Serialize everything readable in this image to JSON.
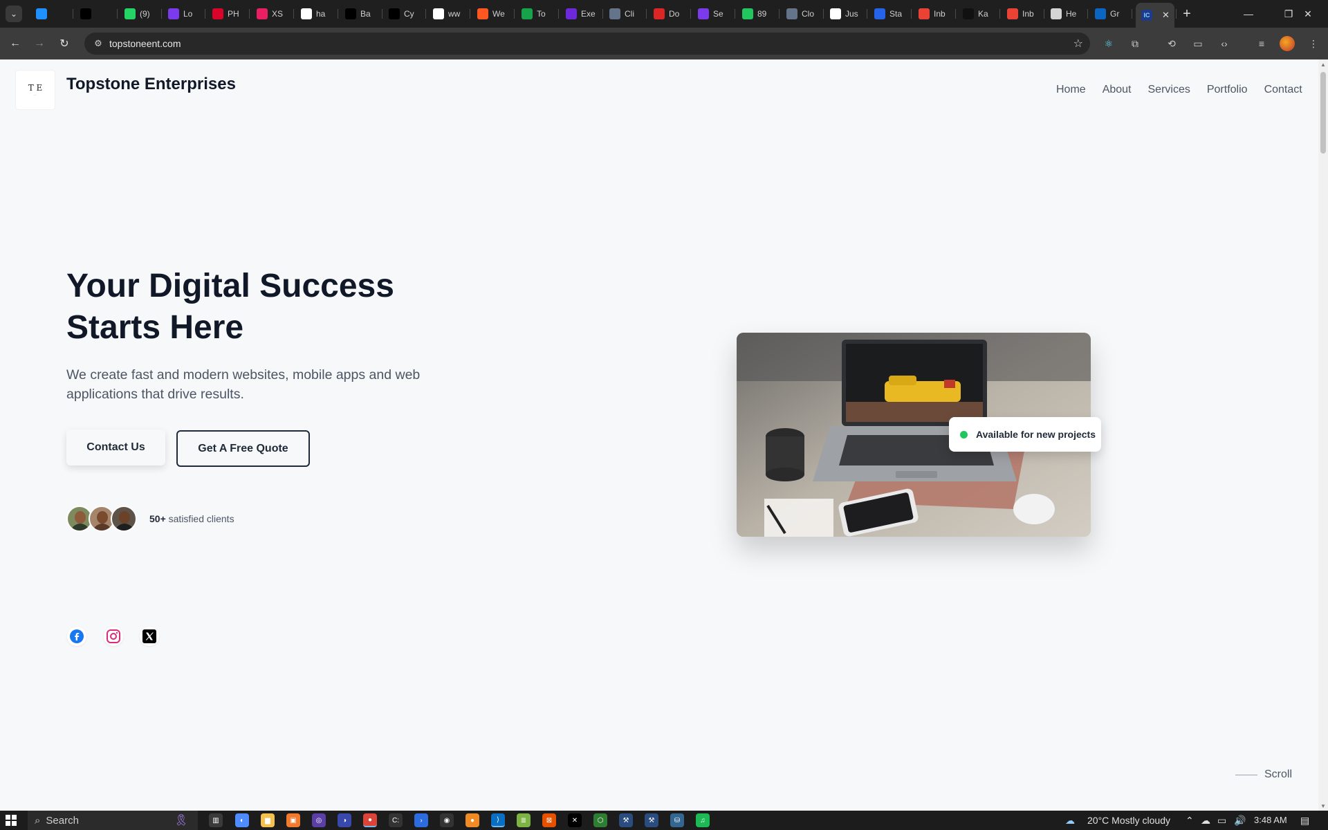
{
  "browser": {
    "tabs": [
      {
        "label": "",
        "favicon": "stripe-icon",
        "color": "#1e90ff"
      },
      {
        "label": "",
        "favicon": "x-icon",
        "color": "#000000"
      },
      {
        "label": "(9)",
        "favicon": "whatsapp-icon",
        "color": "#25d366"
      },
      {
        "label": "Lo",
        "favicon": "purple-u-icon",
        "color": "#7c3aed"
      },
      {
        "label": "PH",
        "favicon": "v-red-icon",
        "color": "#d90429"
      },
      {
        "label": "XS",
        "favicon": "hoi-icon",
        "color": "#e91e63"
      },
      {
        "label": "ha",
        "favicon": "house-icon",
        "color": "#ffffff"
      },
      {
        "label": "Ba",
        "favicon": "r-black-icon",
        "color": "#000000"
      },
      {
        "label": "Cy",
        "favicon": "r-black-icon",
        "color": "#000000"
      },
      {
        "label": "ww",
        "favicon": "white-square-icon",
        "color": "#ffffff"
      },
      {
        "label": "We",
        "favicon": "orange-icon",
        "color": "#ff5722"
      },
      {
        "label": "To",
        "favicon": "green-link-icon",
        "color": "#16a34a"
      },
      {
        "label": "Exe",
        "favicon": "bracket-icon",
        "color": "#6d28d9"
      },
      {
        "label": "Cli",
        "favicon": "cloud-icon",
        "color": "#64748b"
      },
      {
        "label": "Do",
        "favicon": "red-shield-icon",
        "color": "#dc2626"
      },
      {
        "label": "Se",
        "favicon": "purple-u-icon",
        "color": "#7c3aed"
      },
      {
        "label": "89",
        "favicon": "mic-icon",
        "color": "#22c55e"
      },
      {
        "label": "Clo",
        "favicon": "bars-icon",
        "color": "#64748b"
      },
      {
        "label": "Jus",
        "favicon": "w-icon",
        "color": "#ffffff"
      },
      {
        "label": "Sta",
        "favicon": "blue-circle-icon",
        "color": "#2563eb"
      },
      {
        "label": "Inb",
        "favicon": "gmail-icon",
        "color": "#ea4335"
      },
      {
        "label": "Ka",
        "favicon": "dark-icon",
        "color": "#111111"
      },
      {
        "label": "Inb",
        "favicon": "gmail-icon",
        "color": "#ea4335"
      },
      {
        "label": "He",
        "favicon": "ring-icon",
        "color": "#d4d4d4"
      },
      {
        "label": "Gr",
        "favicon": "linkedin-icon",
        "color": "#0a66c2"
      },
      {
        "label": "",
        "favicon": "youtube-icon",
        "color": "#ff0000"
      }
    ],
    "active_tab_favicon": "topstone-icon",
    "url": "topstoneent.com"
  },
  "site": {
    "brand": "Topstone Enterprises",
    "logo_mark": "T E",
    "nav": [
      "Home",
      "About",
      "Services",
      "Portfolio",
      "Contact"
    ],
    "hero": {
      "title_line1": "Your Digital Success",
      "title_line2": "Starts Here",
      "subtitle": "We create fast and modern websites, mobile apps and web applications that drive results.",
      "cta_primary": "Contact Us",
      "cta_secondary": "Get A Free Quote",
      "clients_count": "50+",
      "clients_text": "satisfied clients",
      "badge": "Available for new projects",
      "scroll": "Scroll"
    },
    "social": [
      "facebook-icon",
      "instagram-icon",
      "x-icon"
    ]
  },
  "taskbar": {
    "search_placeholder": "Search",
    "weather": "20°C  Mostly cloudy",
    "time": "3:48 AM"
  },
  "colors": {
    "accent_dark": "#111827",
    "available_dot": "#22c55e",
    "page_bg": "#f7f8fa"
  }
}
